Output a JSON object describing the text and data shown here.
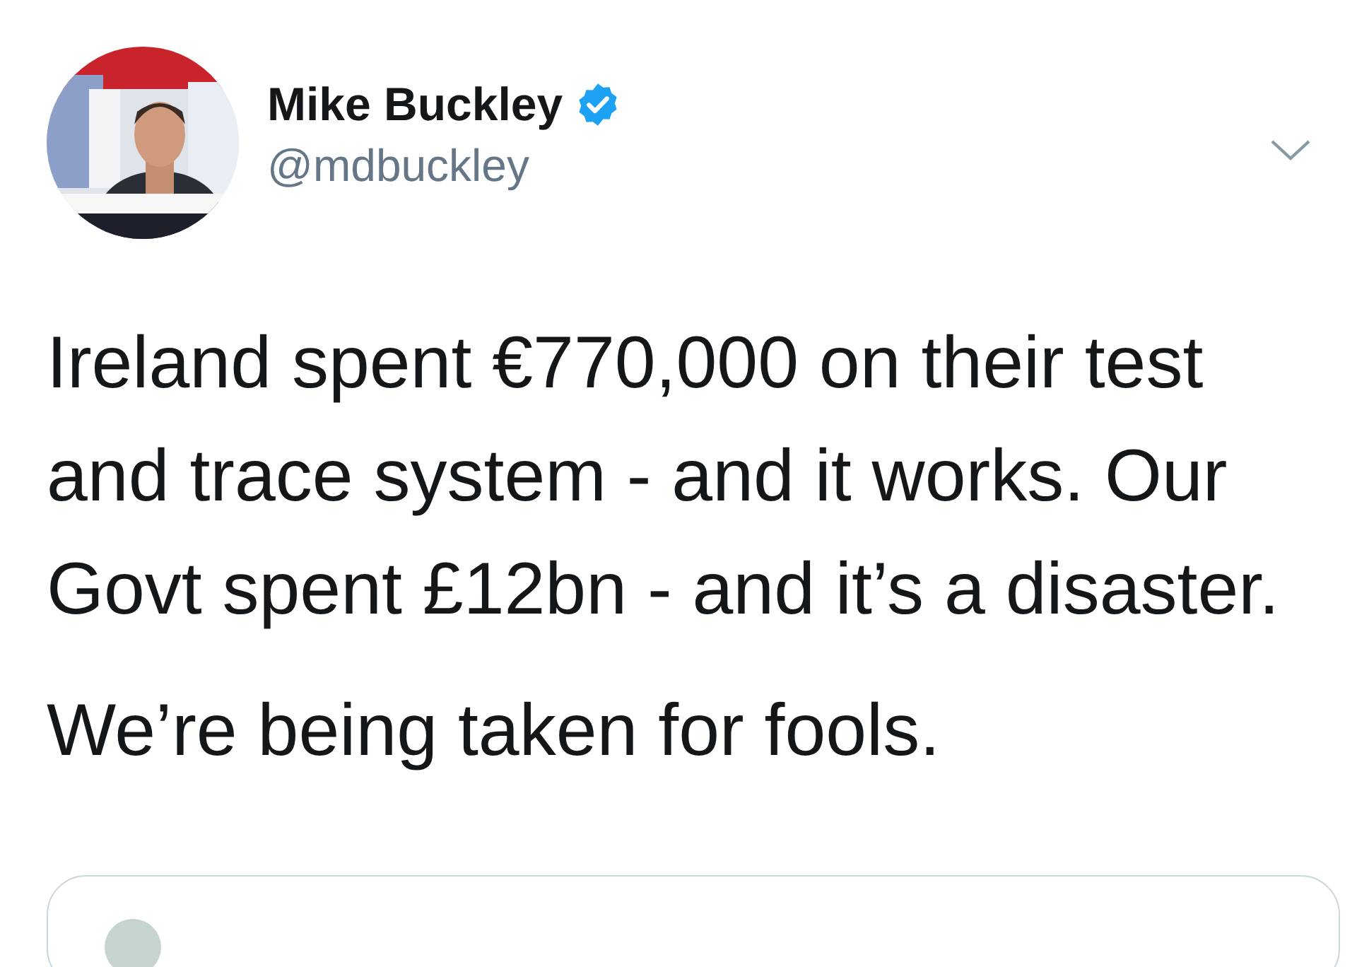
{
  "author": {
    "name": "Mike Buckley",
    "handle": "@mdbuckley",
    "verified": true
  },
  "tweet": {
    "paragraphs": [
      "Ireland spent €770,000 on their test and trace system - and it works. Our Govt spent £12bn - and it’s a disaster.",
      "We’re being taken for fools."
    ]
  },
  "quoted_card": {
    "kind": "card"
  }
}
